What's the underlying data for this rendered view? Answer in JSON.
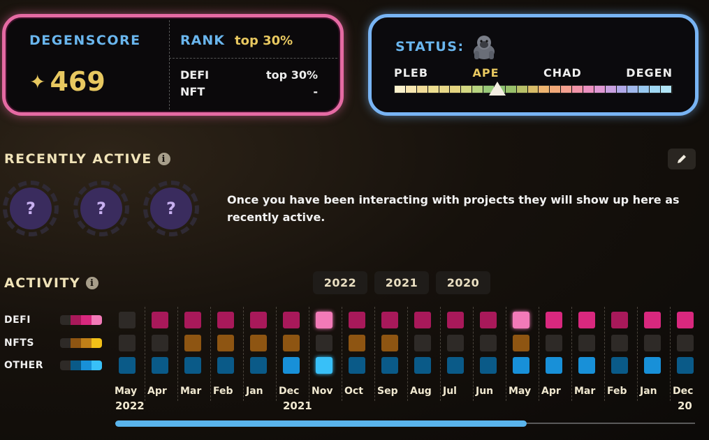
{
  "score": {
    "title": "DEGENSCORE",
    "value": "469",
    "rank_label": "RANK",
    "rank_value": "top 30%",
    "defi_label": "DEFI",
    "defi_value": "top 30%",
    "nft_label": "NFT",
    "nft_value": "-"
  },
  "status": {
    "title": "STATUS:",
    "icon": "gorilla-icon",
    "levels": [
      "PLEB",
      "APE",
      "CHAD",
      "DEGEN"
    ],
    "current": "APE",
    "marker_fraction": 0.37
  },
  "recent": {
    "title": "RECENTLY ACTIVE",
    "empty_text": "Once you have been interacting with projects they will show up here as recently active.",
    "placeholder": "?"
  },
  "activity": {
    "title": "ACTIVITY",
    "years": [
      "2022",
      "2021",
      "2020"
    ],
    "rows": [
      "DEFI",
      "NFTS",
      "OTHER"
    ],
    "months": [
      "May",
      "Apr",
      "Mar",
      "Feb",
      "Jan",
      "Dec",
      "Nov",
      "Oct",
      "Sep",
      "Aug",
      "Jul",
      "Jun",
      "May",
      "Apr",
      "Mar",
      "Feb",
      "Jan",
      "Dec"
    ],
    "year_labels": [
      "2022",
      "2021",
      "20"
    ],
    "scroll_fraction": 0.71
  },
  "colors": {
    "defi": [
      "#2e2a27",
      "#a8195a",
      "#d8287e",
      "#f27ab8"
    ],
    "nfts": [
      "#2e2a27",
      "#8e5512",
      "#c08018",
      "#f2c018"
    ],
    "other": [
      "#2e2a27",
      "#0a5a88",
      "#1890d8",
      "#38c0f8"
    ]
  },
  "levels": {
    "defi": [
      0,
      1,
      1,
      1,
      1,
      1,
      3,
      1,
      1,
      1,
      1,
      1,
      3,
      2,
      2,
      1,
      2,
      2
    ],
    "nfts": [
      0,
      0,
      1,
      1,
      1,
      1,
      0,
      1,
      1,
      0,
      0,
      0,
      1,
      0,
      0,
      0,
      0,
      0
    ],
    "other": [
      1,
      1,
      1,
      1,
      1,
      2,
      3,
      1,
      1,
      1,
      1,
      1,
      2,
      2,
      2,
      1,
      2,
      1
    ]
  }
}
